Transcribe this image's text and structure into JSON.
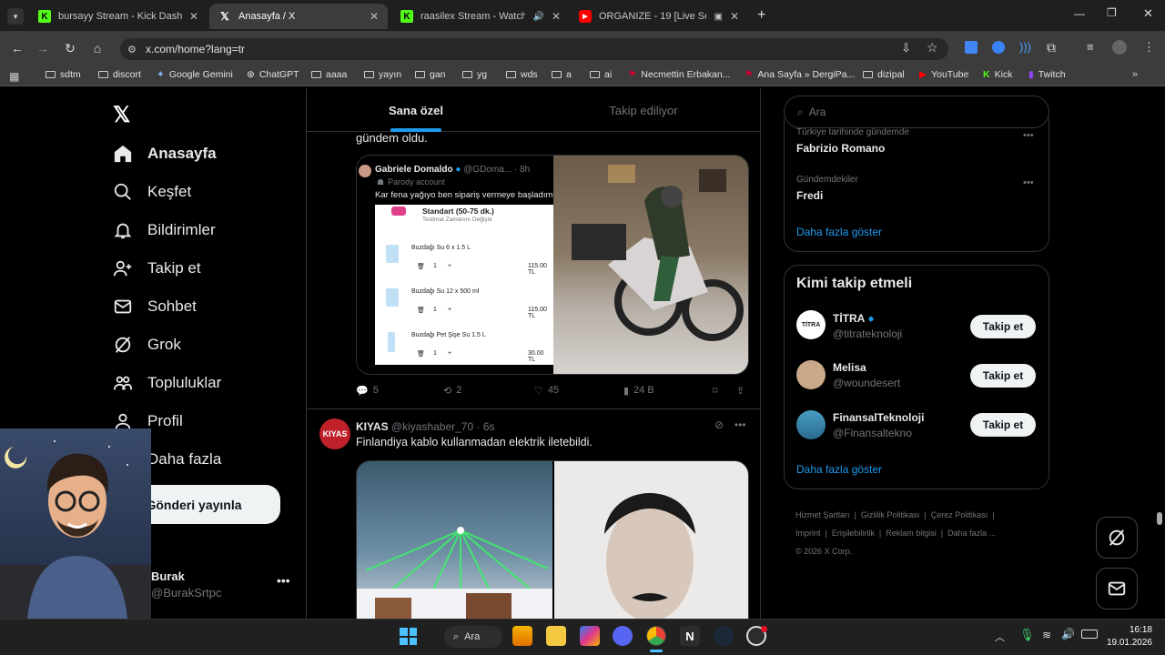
{
  "browser": {
    "tabs": [
      {
        "title": "bursayy Stream - Kick Dashboard",
        "icon": "K"
      },
      {
        "title": "Anasayfa / X",
        "icon": "X"
      },
      {
        "title": "raasilex Stream - Watch Live",
        "icon": "K"
      },
      {
        "title": "ORGANIZE - 19 [Live Session]",
        "icon": "yt"
      }
    ],
    "url": "x.com/home?lang=tr",
    "bookmarks": [
      "sdtm",
      "discort",
      "Google Gemini",
      "ChatGPT",
      "aaaa",
      "yayın",
      "gan",
      "yg",
      "wds",
      "a",
      "ai",
      "Necmettin Erbakan...",
      "Ana Sayfa » DergiPa...",
      "dizipal",
      "YouTube",
      "Kick",
      "Twitch"
    ]
  },
  "nav": {
    "items": [
      "Anasayfa",
      "Keşfet",
      "Bildirimler",
      "Takip et",
      "Sohbet",
      "Grok",
      "Topluluklar",
      "Profil",
      "Daha fazla"
    ],
    "post_button": "Gönderi yayınla",
    "user_name": "Burak",
    "user_handle": "@BurakSrtpc"
  },
  "feed": {
    "tab_foryou": "Sana özel",
    "tab_following": "Takip ediliyor",
    "prev_text": "gündem oldu.",
    "quoted": {
      "name": "Gabriele Domaldo",
      "handle": "@GDoma...",
      "time": "8h",
      "label": "Parody account",
      "text": "Kar fena yağıyo ben sipariş vermeye başladım",
      "order_title": "Standart (50-75 dk.)",
      "order_sub": "Teslimat Zamanını Değiştir",
      "items": [
        {
          "name": "Buzdağı Su 6 x 1.5 L",
          "qty": "1",
          "price": "115.00 TL"
        },
        {
          "name": "Buzdağı Su 12 x 500 ml",
          "qty": "1",
          "price": "115.00 TL"
        },
        {
          "name": "Buzdağı Pet Şişe Su 1.5 L",
          "qty": "1",
          "price": "30.00 TL"
        }
      ]
    },
    "stats": {
      "replies": "5",
      "reposts": "2",
      "likes": "45",
      "views": "24 B"
    },
    "post2": {
      "avatar_text": "KIYAS",
      "name": "KIYAS",
      "handle": "@kiyashaber_70",
      "time": "6s",
      "text": "Finlandiya kablo kullanmadan elektrik iletebildi."
    }
  },
  "right": {
    "search_placeholder": "Ara",
    "trend1_meta": "Türkiye tarihinde gündemde",
    "trend1_name": "Fabrizio Romano",
    "trend2_meta": "Gündemdekiler",
    "trend2_name": "Fredi",
    "show_more": "Daha fazla göster",
    "who_title": "Kimi takip etmeli",
    "follow_label": "Takip et",
    "suggestions": [
      {
        "name": "TİTRA",
        "handle": "@titrateknoloji"
      },
      {
        "name": "Melisa",
        "handle": "@woundesert"
      },
      {
        "name": "FinansalTeknoloji",
        "handle": "@Finansaltekno"
      }
    ],
    "show_more2": "Daha fazla göster",
    "footer": [
      "Hizmet Şartları",
      "Gizlilik Politikası",
      "Çerez Politikası",
      "Imprint",
      "Erişilebilirlik",
      "Reklam bilgisi",
      "Daha fazla ..."
    ],
    "copyright": "© 2026 X Corp."
  },
  "taskbar": {
    "search": "Ara",
    "time": "16:18",
    "date": "19.01.2026"
  }
}
